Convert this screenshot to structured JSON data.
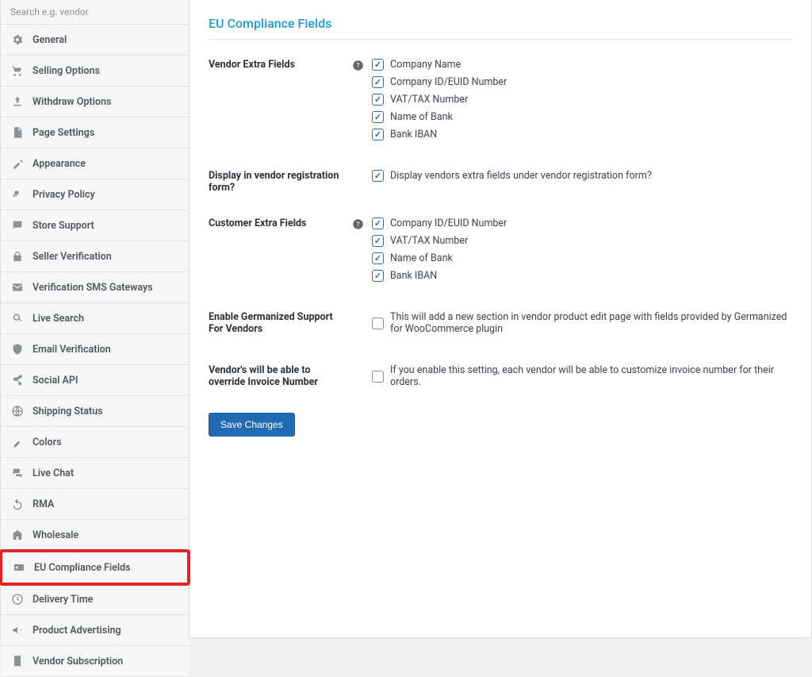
{
  "search": {
    "placeholder": "Search e.g. vendor"
  },
  "sidebar": {
    "items": [
      {
        "label": "General"
      },
      {
        "label": "Selling Options"
      },
      {
        "label": "Withdraw Options"
      },
      {
        "label": "Page Settings"
      },
      {
        "label": "Appearance"
      },
      {
        "label": "Privacy Policy"
      },
      {
        "label": "Store Support"
      },
      {
        "label": "Seller Verification"
      },
      {
        "label": "Verification SMS Gateways"
      },
      {
        "label": "Live Search"
      },
      {
        "label": "Email Verification"
      },
      {
        "label": "Social API"
      },
      {
        "label": "Shipping Status"
      },
      {
        "label": "Colors"
      },
      {
        "label": "Live Chat"
      },
      {
        "label": "RMA"
      },
      {
        "label": "Wholesale"
      },
      {
        "label": "EU Compliance Fields"
      },
      {
        "label": "Delivery Time"
      },
      {
        "label": "Product Advertising"
      },
      {
        "label": "Vendor Subscription"
      }
    ]
  },
  "page": {
    "title": "EU Compliance Fields",
    "sections": {
      "vendor_extra": {
        "label": "Vendor Extra Fields",
        "options": [
          {
            "label": "Company Name",
            "checked": true
          },
          {
            "label": "Company ID/EUID Number",
            "checked": true
          },
          {
            "label": "VAT/TAX Number",
            "checked": true
          },
          {
            "label": "Name of Bank",
            "checked": true
          },
          {
            "label": "Bank IBAN",
            "checked": true
          }
        ]
      },
      "display_registration": {
        "label": "Display in vendor registration form?",
        "option": {
          "label": "Display vendors extra fields under vendor registration form?",
          "checked": true
        }
      },
      "customer_extra": {
        "label": "Customer Extra Fields",
        "options": [
          {
            "label": "Company ID/EUID Number",
            "checked": true
          },
          {
            "label": "VAT/TAX Number",
            "checked": true
          },
          {
            "label": "Name of Bank",
            "checked": true
          },
          {
            "label": "Bank IBAN",
            "checked": true
          }
        ]
      },
      "germanized": {
        "label": "Enable Germanized Support For Vendors",
        "option": {
          "label": "This will add a new section in vendor product edit page with fields provided by Germanized for WooCommerce plugin",
          "checked": false
        }
      },
      "invoice_override": {
        "label": "Vendor's will be able to override Invoice Number",
        "option": {
          "label": "If you enable this setting, each vendor will be able to customize invoice number for their orders.",
          "checked": false
        }
      }
    },
    "save_label": "Save Changes"
  }
}
